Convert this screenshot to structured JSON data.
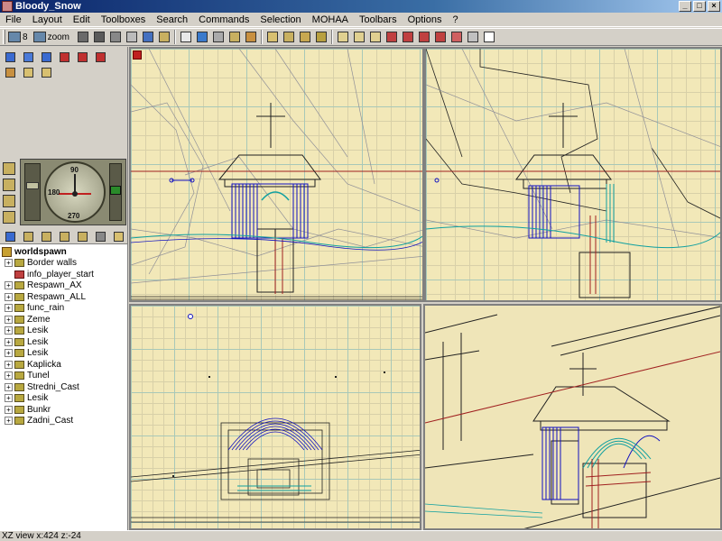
{
  "window": {
    "title": "Bloody_Snow"
  },
  "menu": [
    "File",
    "Layout",
    "Edit",
    "Toolboxes",
    "Search",
    "Commands",
    "Selection",
    "MOHAA",
    "Toolbars",
    "Options",
    "?"
  ],
  "toolbar": {
    "grid_value": "8",
    "zoom_label": "zoom"
  },
  "compass": {
    "north": "90",
    "west": "180",
    "south": "270"
  },
  "tree": {
    "root": "worldspawn",
    "items": [
      {
        "label": "Border walls",
        "icon": "brush-icon",
        "expandable": true
      },
      {
        "label": "info_player_start",
        "icon": "player-start-icon",
        "expandable": false
      },
      {
        "label": "Respawn_AX",
        "icon": "brush-icon",
        "expandable": true
      },
      {
        "label": "Respawn_ALL",
        "icon": "brush-icon",
        "expandable": true
      },
      {
        "label": "func_rain",
        "icon": "brush-icon",
        "expandable": true
      },
      {
        "label": "Zeme",
        "icon": "brush-icon",
        "expandable": true
      },
      {
        "label": "Lesik",
        "icon": "brush-icon",
        "expandable": true
      },
      {
        "label": "Lesik",
        "icon": "brush-icon",
        "expandable": true
      },
      {
        "label": "Lesik",
        "icon": "brush-icon",
        "expandable": true
      },
      {
        "label": "Kaplicka",
        "icon": "brush-icon",
        "expandable": true
      },
      {
        "label": "Tunel",
        "icon": "brush-icon",
        "expandable": true
      },
      {
        "label": "Stredni_Cast",
        "icon": "brush-icon",
        "expandable": true
      },
      {
        "label": "Lesik",
        "icon": "brush-icon",
        "expandable": true
      },
      {
        "label": "Bunkr",
        "icon": "brush-icon",
        "expandable": true
      },
      {
        "label": "Zadni_Cast",
        "icon": "brush-icon",
        "expandable": true
      }
    ]
  },
  "status": {
    "text": "XZ view x:424 z:-24"
  },
  "colors": {
    "grid_bg": "#f2e8b8",
    "grid_major": "#a8c8b8",
    "wire_blue": "#1010c0",
    "wire_teal": "#10a0a0",
    "wire_red": "#a02020"
  }
}
